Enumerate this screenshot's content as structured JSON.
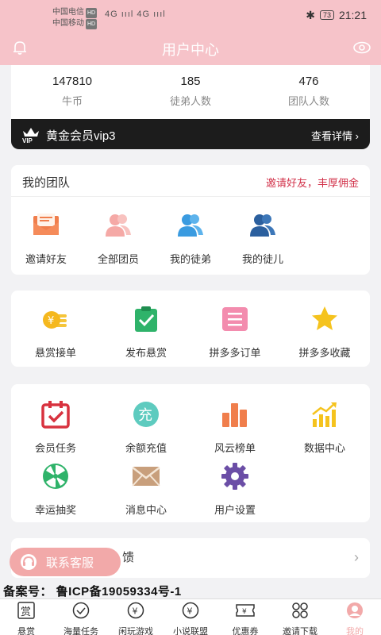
{
  "status": {
    "carrier1": "中国电信",
    "carrier2": "中国移动",
    "hd": "HD",
    "signal": "4G ıııl 4G ıııl",
    "battery": "73",
    "time": "21:21"
  },
  "header": {
    "title": "用户中心"
  },
  "stats": [
    {
      "value": "147810",
      "label": "牛币"
    },
    {
      "value": "185",
      "label": "徒弟人数"
    },
    {
      "value": "476",
      "label": "团队人数"
    }
  ],
  "vip": {
    "title": "黄金会员vip3",
    "detail": "查看详情"
  },
  "team": {
    "title": "我的团队",
    "invite_text": "邀请好友，丰厚佣金",
    "items": [
      {
        "label": "邀请好友",
        "icon": "envelope-icon"
      },
      {
        "label": "全部团员",
        "icon": "group-icon"
      },
      {
        "label": "我的徒弟",
        "icon": "users-icon"
      },
      {
        "label": "我的徒儿",
        "icon": "users-dark-icon"
      }
    ]
  },
  "services": {
    "items": [
      {
        "label": "悬赏接单",
        "icon": "coins-icon"
      },
      {
        "label": "发布悬赏",
        "icon": "clipboard-check-icon"
      },
      {
        "label": "拼多多订单",
        "icon": "list-icon"
      },
      {
        "label": "拼多多收藏",
        "icon": "star-icon"
      }
    ]
  },
  "tools": {
    "items": [
      {
        "label": "会员任务",
        "icon": "calendar-check-icon"
      },
      {
        "label": "余额充值",
        "icon": "recharge-icon"
      },
      {
        "label": "风云榜单",
        "icon": "bar-chart-icon"
      },
      {
        "label": "数据中心",
        "icon": "growth-chart-icon"
      },
      {
        "label": "幸运抽奖",
        "icon": "wheel-icon"
      },
      {
        "label": "消息中心",
        "icon": "mail-icon"
      },
      {
        "label": "用户设置",
        "icon": "settings-icon"
      }
    ]
  },
  "feedback": {
    "label": "馈"
  },
  "service_button": {
    "label": "联系客服"
  },
  "icp": "备案号： 鲁ICP备19059334号-1",
  "tabs": [
    {
      "label": "悬赏",
      "icon": "reward-icon"
    },
    {
      "label": "海量任务",
      "icon": "check-circle-icon"
    },
    {
      "label": "闲玩游戏",
      "icon": "yen-circle-icon"
    },
    {
      "label": "小说联盟",
      "icon": "yen-circle-icon"
    },
    {
      "label": "优惠券",
      "icon": "coupon-icon"
    },
    {
      "label": "邀请下载",
      "icon": "apps-icon"
    },
    {
      "label": "我的",
      "icon": "profile-icon"
    }
  ],
  "colors": {
    "header": "#f6c3c9",
    "accent": "#f2a9a9",
    "invite": "#d2324a",
    "vip_bg": "#1c1c1c"
  }
}
